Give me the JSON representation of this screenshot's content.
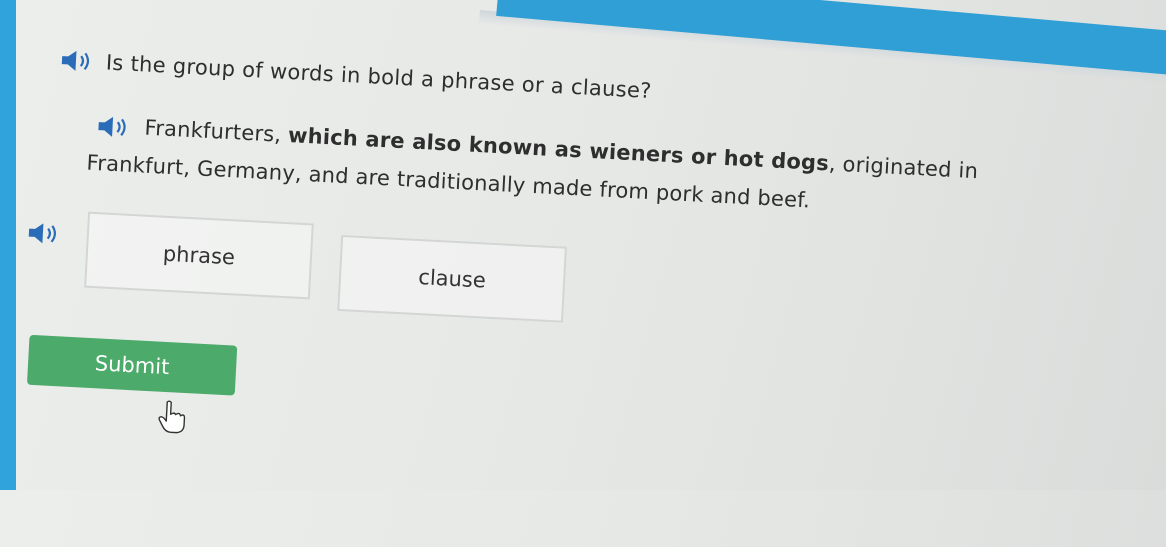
{
  "question": {
    "speaker_icon": "speaker-icon",
    "text": "Is the group of words in bold a phrase or a clause?"
  },
  "sentence": {
    "speaker_icon": "speaker-icon",
    "part1": "Frankfurters, ",
    "bold": "which are also known as wieners or hot dogs",
    "part2": ", originated in",
    "line2": "Frankfurt, Germany, and are traditionally made from pork and beef."
  },
  "choices": {
    "speaker_icon": "speaker-icon",
    "options": [
      "phrase",
      "clause"
    ]
  },
  "submit": {
    "label": "Submit"
  },
  "colors": {
    "accent_blue": "#31a3dc",
    "submit_green": "#4caa6a",
    "text": "#2e2e2e"
  }
}
